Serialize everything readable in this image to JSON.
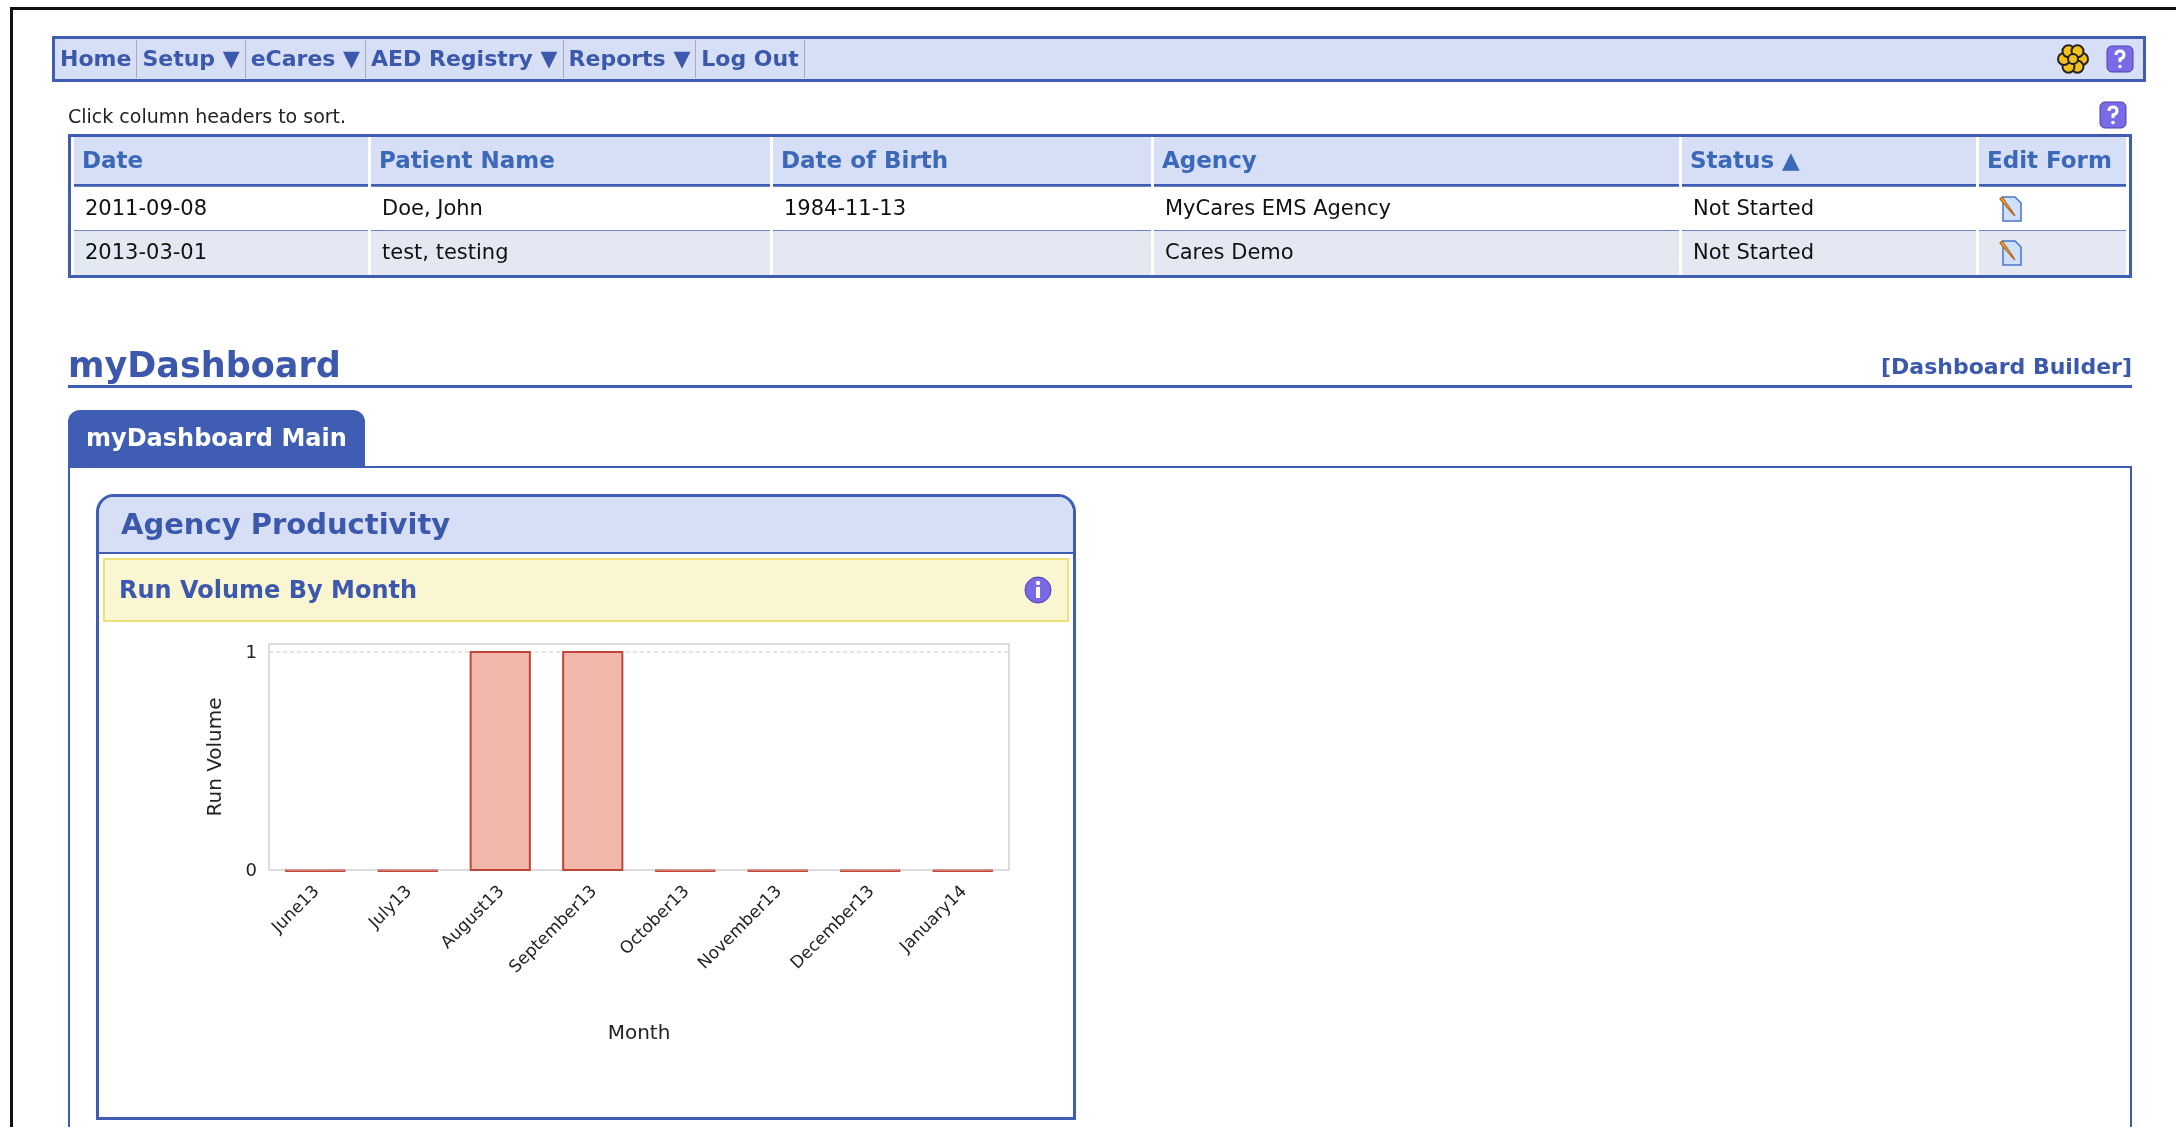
{
  "nav": {
    "items": [
      {
        "label": "Home"
      },
      {
        "label": "Setup",
        "caret": "▼"
      },
      {
        "label": "eCares",
        "caret": "▼"
      },
      {
        "label": "AED Registry",
        "caret": "▼"
      },
      {
        "label": "Reports",
        "caret": "▼"
      },
      {
        "label": "Log Out"
      }
    ]
  },
  "hint": "Click column headers to sort.",
  "table": {
    "columns": [
      {
        "label": "Date"
      },
      {
        "label": "Patient Name"
      },
      {
        "label": "Date of Birth"
      },
      {
        "label": "Agency"
      },
      {
        "label": "Status",
        "sort": "▲"
      },
      {
        "label": "Edit Form"
      }
    ],
    "rows": [
      [
        "2011-09-08",
        "Doe, John",
        "1984-11-13",
        "MyCares EMS Agency",
        "Not Started"
      ],
      [
        "2013-03-01",
        "test, testing",
        "",
        "Cares Demo",
        "Not Started"
      ]
    ]
  },
  "dashboard": {
    "title": "myDashboard",
    "builder_link": "[Dashboard Builder]",
    "tabs": [
      {
        "label": "myDashboard Main",
        "selected": true
      }
    ],
    "widget": {
      "title": "Agency Productivity",
      "subtitle": "Run Volume By Month",
      "chart_data": {
        "type": "bar",
        "xlabel": "Month",
        "ylabel": "Run Volume",
        "categories": [
          "June13",
          "July13",
          "August13",
          "September13",
          "October13",
          "November13",
          "December13",
          "January14"
        ],
        "series": [
          {
            "color": "#f2b8ab",
            "values": [
              0,
              0,
              1,
              1,
              0,
              0,
              0,
              0
            ]
          }
        ],
        "ylim": [
          0,
          1
        ],
        "yticks": [
          0,
          1
        ]
      }
    }
  }
}
